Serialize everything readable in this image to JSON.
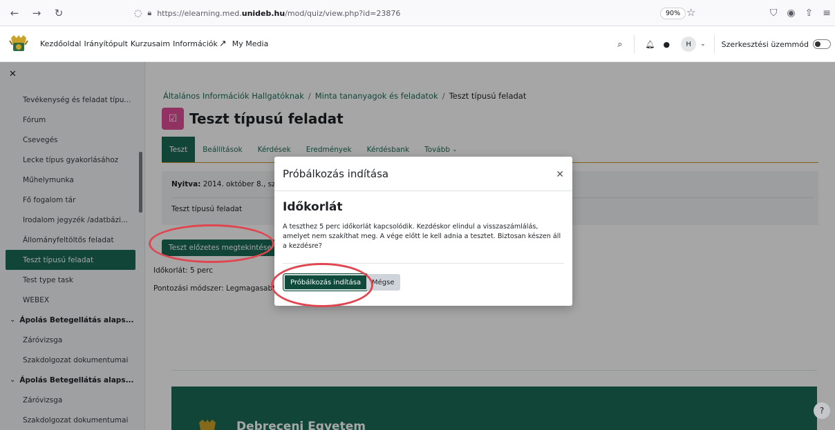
{
  "browser": {
    "url_prefix": "https://elearning.med.",
    "url_domain": "unideb.hu",
    "url_suffix": "/mod/quiz/view.php?id=23876",
    "zoom": "90%"
  },
  "navbar": {
    "links": [
      "Kezdőoldal",
      "Irányítópult",
      "Kurzusaim",
      "Információk",
      "My Media"
    ],
    "avatar_initial": "H",
    "edit_mode_label": "Szerkesztési üzemmód"
  },
  "sidebar": {
    "items": [
      {
        "label": "Tevékenység és feladat típu...",
        "type": "item"
      },
      {
        "label": "Fórum",
        "type": "item"
      },
      {
        "label": "Csevegés",
        "type": "item"
      },
      {
        "label": "Lecke típus gyakorlásához",
        "type": "item"
      },
      {
        "label": "Műhelymunka",
        "type": "item"
      },
      {
        "label": "Fő fogalom tár",
        "type": "item"
      },
      {
        "label": "Irodalom jegyzék /adatbázi...",
        "type": "item"
      },
      {
        "label": "Állományfeltöltős feladat",
        "type": "item"
      },
      {
        "label": "Teszt típusú feladat",
        "type": "active"
      },
      {
        "label": "Test type task",
        "type": "item"
      },
      {
        "label": "WEBEX",
        "type": "item"
      },
      {
        "label": "Ápolás Betegellátás alaps...",
        "type": "section"
      },
      {
        "label": "Záróvizsga",
        "type": "item"
      },
      {
        "label": "Szakdolgozat dokumentumai",
        "type": "item"
      },
      {
        "label": "Ápolás Betegellátás alaps...",
        "type": "section"
      },
      {
        "label": "Záróvizsga",
        "type": "item"
      },
      {
        "label": "Szakdolgozat dokumentumai",
        "type": "item"
      }
    ]
  },
  "breadcrumb": {
    "first": "Általános Információk Hallgatóknak",
    "second": "Minta tananyagok és feladatok",
    "current": "Teszt típusú feladat"
  },
  "page": {
    "title": "Teszt típusú feladat",
    "tabs": [
      "Teszt",
      "Beállítások",
      "Kérdések",
      "Eredmények",
      "Kérdésbank",
      "Tovább"
    ],
    "opened_label": "Nyitva:",
    "opened_value": "2014. október 8., szerda",
    "description": "Teszt típusú feladat",
    "preview_button": "Teszt előzetes megtekintése",
    "time_limit": "Időkorlát: 5 perc",
    "grading_method": "Pontozási módszer: Legmagasabb"
  },
  "footer": {
    "name": "Debreceni Egyetem"
  },
  "modal": {
    "title": "Próbálkozás indítása",
    "heading": "Időkorlát",
    "body": "A teszthez 5 perc időkorlát kapcsolódik. Kezdéskor elindul a visszaszámlálás, amelyet nem szakíthat meg. A vége előtt le kell adnia a tesztet. Biztosan készen áll a kezdésre?",
    "start_button": "Próbálkozás indítása",
    "cancel_button": "Mégse"
  },
  "colors": {
    "primary": "#1b6b56",
    "annotation": "#e0464f",
    "quiz_icon": "#e04d97"
  }
}
